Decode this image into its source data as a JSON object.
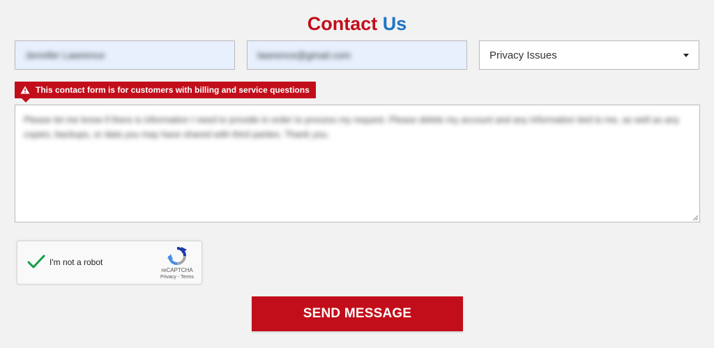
{
  "header": {
    "title_part1": "Contact",
    "title_part2": "Us"
  },
  "form": {
    "name_value": "Jennifer Lawrence",
    "email_value": "lawrence@gmail.com",
    "topic_selected": "Privacy Issues",
    "notice": "This contact form is for customers with billing and service questions",
    "message_value": "Please let me know if there is information I need to provide in order to process my request. Please delete my account and any information tied to me, as well as any copies, backups, or data you may have shared with third parties. Thank you."
  },
  "captcha": {
    "label": "I'm not a robot",
    "brand": "reCAPTCHA",
    "links": "Privacy - Terms"
  },
  "actions": {
    "send_label": "SEND MESSAGE"
  },
  "colors": {
    "brand_red": "#c20e1a",
    "brand_blue": "#1f74c4",
    "autofill_bg": "#e8f0fe"
  }
}
